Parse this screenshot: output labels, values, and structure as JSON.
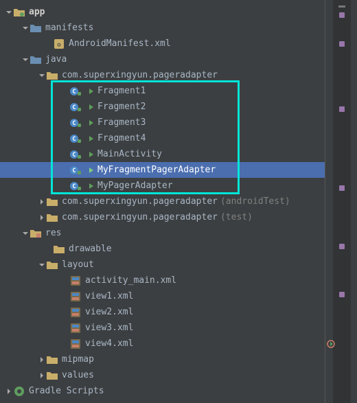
{
  "tree": {
    "app": "app",
    "manifests": "manifests",
    "androidManifest": "AndroidManifest.xml",
    "java": "java",
    "package": "com.superxingyun.pageradapter",
    "fragment1": "Fragment1",
    "fragment2": "Fragment2",
    "fragment3": "Fragment3",
    "fragment4": "Fragment4",
    "mainActivity": "MainActivity",
    "myFragmentPagerAdapter": "MyFragmentPagerAdapter",
    "myPagerAdapter": "MyPagerAdapter",
    "packageAndroidTest": "com.superxingyun.pageradapter",
    "packageAndroidTestSuffix": "(androidTest)",
    "packageTest": "com.superxingyun.pageradapter",
    "packageTestSuffix": "(test)",
    "res": "res",
    "drawable": "drawable",
    "layout": "layout",
    "activityMain": "activity_main.xml",
    "view1": "view1.xml",
    "view2": "view2.xml",
    "view3": "view3.xml",
    "view4": "view4.xml",
    "mipmap": "mipmap",
    "values": "values",
    "gradleScripts": "Gradle Scripts"
  }
}
